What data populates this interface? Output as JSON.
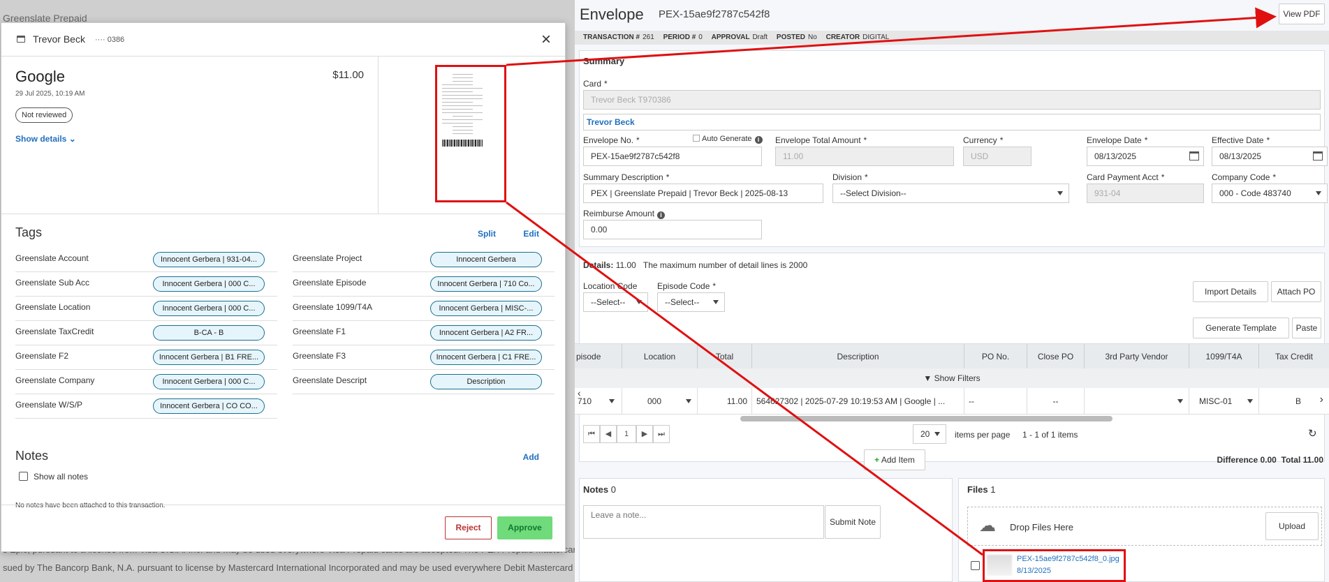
{
  "background": {
    "title": "Greenslate Prepaid",
    "lines": [
      "s Epic, pursuant to a license from Visa U.S.A. Inc. and may be used everywhere Visa Prepaid cards are accepted. The PEX Prepaid Mastercard",
      "sued by The Bancorp Bank, N.A. pursuant to license by Mastercard International Incorporated and may be used everywhere Debit Mastercard is"
    ]
  },
  "modal": {
    "cardholder": "Trevor Beck",
    "last4": "···· 0386",
    "close_glyph": "×",
    "merchant": "Google",
    "amount": "$11.00",
    "date": "29 Jul 2025, 10:19 AM",
    "review_status": "Not reviewed",
    "show_details": "Show details",
    "tags_title": "Tags",
    "split_label": "Split",
    "edit_label": "Edit",
    "tags_left": [
      {
        "label": "Greenslate Account",
        "value": "Innocent Gerbera | 931-04..."
      },
      {
        "label": "Greenslate Sub Acc",
        "value": "Innocent Gerbera | 000 C..."
      },
      {
        "label": "Greenslate Location",
        "value": "Innocent Gerbera | 000 C..."
      },
      {
        "label": "Greenslate TaxCredit",
        "value": "B-CA - B"
      },
      {
        "label": "Greenslate F2",
        "value": "Innocent Gerbera | B1 FRE..."
      },
      {
        "label": "Greenslate Company",
        "value": "Innocent Gerbera | 000 C..."
      },
      {
        "label": "Greenslate W/S/P",
        "value": "Innocent Gerbera | CO CO..."
      }
    ],
    "tags_right": [
      {
        "label": "Greenslate Project",
        "value": "Innocent Gerbera"
      },
      {
        "label": "Greenslate Episode",
        "value": "Innocent Gerbera | 710 Co..."
      },
      {
        "label": "Greenslate 1099/T4A",
        "value": "Innocent Gerbera | MISC-..."
      },
      {
        "label": "Greenslate F1",
        "value": "Innocent Gerbera | A2 FR..."
      },
      {
        "label": "Greenslate F3",
        "value": "Innocent Gerbera | C1 FRE..."
      },
      {
        "label": "Greenslate Descript",
        "value": "Description"
      }
    ],
    "notes_title": "Notes",
    "notes_add": "Add",
    "show_all_notes": "Show all notes",
    "no_notes": "No notes have been attached to this transaction.",
    "reject_label": "Reject",
    "approve_label": "Approve"
  },
  "envelope": {
    "title": "Envelope",
    "id": "PEX-15ae9f2787c542f8",
    "view_pdf": "View PDF",
    "meta": {
      "transaction_label": "TRANSACTION #",
      "transaction": "261",
      "period_label": "PERIOD #",
      "period": "0",
      "approval_label": "APPROVAL",
      "approval": "Draft",
      "posted_label": "POSTED",
      "posted": "No",
      "creator_label": "CREATOR",
      "creator": "DIGITAL"
    },
    "summary": {
      "title": "Summary",
      "card_label": "Card",
      "card_value": "Trevor Beck T970386",
      "cardholder_link": "Trevor Beck",
      "envelope_no_label": "Envelope No.",
      "envelope_no": "PEX-15ae9f2787c542f8",
      "auto_generate": "Auto Generate",
      "total_label": "Envelope Total Amount",
      "total": "11.00",
      "currency_label": "Currency",
      "currency": "USD",
      "env_date_label": "Envelope Date",
      "env_date": "08/13/2025",
      "eff_date_label": "Effective Date",
      "eff_date": "08/13/2025",
      "sum_desc_label": "Summary Description",
      "sum_desc": "PEX | Greenslate Prepaid | Trevor Beck | 2025-08-13",
      "division_label": "Division",
      "division": "--Select Division--",
      "card_pay_label": "Card Payment Acct",
      "card_pay": "931-04",
      "company_label": "Company Code",
      "company": "000 - Code 483740",
      "reimburse_label": "Reimburse Amount",
      "reimburse": "0.00",
      "required_mark": "*"
    },
    "details": {
      "title": "Details:",
      "amount": "11.00",
      "max_lines": "The maximum number of detail lines is 2000",
      "location_code_label": "Location Code",
      "location_code": "--Select--",
      "episode_code_label": "Episode Code",
      "episode_code": "--Select--",
      "import_details": "Import Details",
      "attach_po": "Attach PO",
      "generate_template": "Generate Template",
      "paste": "Paste",
      "columns": [
        "pisode",
        "Location",
        "Total",
        "Description",
        "PO No.",
        "Close PO",
        "3rd Party Vendor",
        "1099/T4A",
        "Tax Credit"
      ],
      "show_filters": "Show Filters",
      "row": {
        "episode": "710",
        "location": "000",
        "total": "11.00",
        "description": "564627302 | 2025-07-29 10:19:53 AM | Google | ...",
        "po_no": "--",
        "close_po": "--",
        "vendor": "",
        "t4a": "MISC-01",
        "tax_credit": "B"
      },
      "page": "1",
      "page_size": "20",
      "items_per_page": "items per page",
      "items_count": "1 - 1 of 1 items",
      "add_item": "Add Item",
      "difference": "Difference 0.00",
      "total_text": "Total 11.00"
    },
    "notes": {
      "title": "Notes",
      "count": "0",
      "placeholder": "Leave a note...",
      "submit": "Submit Note"
    },
    "files": {
      "title": "Files",
      "count": "1",
      "drop": "Drop Files Here",
      "upload": "Upload",
      "file_name": "PEX-15ae9f2787c542f8_0.jpg",
      "file_date": "8/13/2025"
    }
  },
  "colors": {
    "annotation_red": "#e01010",
    "link_blue": "#1f6fbf",
    "approve_green": "#6fdb7a",
    "pill_border": "#1a6f8c"
  }
}
